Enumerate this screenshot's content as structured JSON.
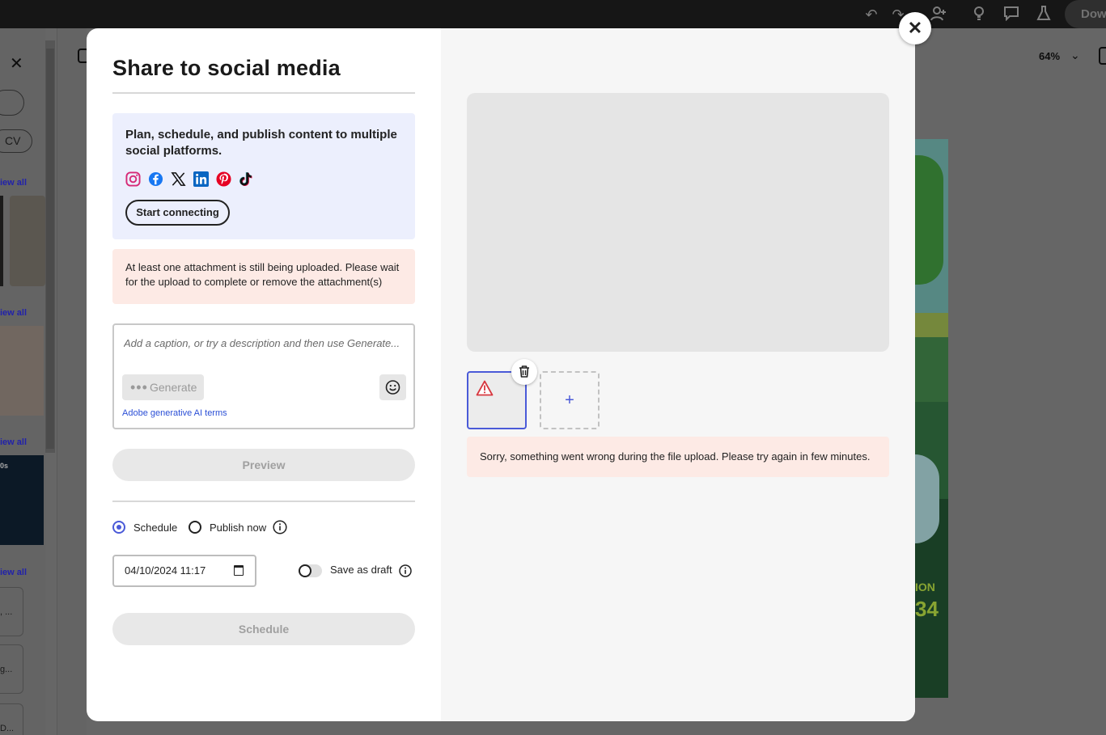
{
  "background": {
    "download_label": "Dow",
    "pill_cv": "CV",
    "view_all_label": "iew all",
    "docs": [
      ", ...",
      "g...",
      "D..."
    ],
    "thumb_text": "0s",
    "zoom_level": "64%",
    "poster_text1": "ION",
    "poster_text2": "34"
  },
  "modal": {
    "title": "Share to social media",
    "promo": {
      "text": "Plan, schedule, and publish content to multiple social platforms.",
      "start_label": "Start connecting",
      "platforms": [
        "instagram-icon",
        "facebook-icon",
        "x-icon",
        "linkedin-icon",
        "pinterest-icon",
        "tiktok-icon"
      ]
    },
    "upload_warning": "At least one attachment is still being uploaded. Please wait for the upload to complete or remove the attachment(s)",
    "caption": {
      "placeholder": "Add a caption, or try a description and then use Generate...",
      "generate_label": "Generate",
      "ai_terms": "Adobe generative AI terms"
    },
    "preview_label": "Preview",
    "publish_options": {
      "schedule_label": "Schedule",
      "publish_now_label": "Publish now",
      "selected": "schedule"
    },
    "date_value": "04/10/2024 11:17",
    "save_draft_label": "Save as draft",
    "save_draft_on": false,
    "schedule_button_label": "Schedule",
    "upload_error": "Sorry, something went wrong during the file upload. Please try again in few minutes.",
    "add_attachment_symbol": "+"
  },
  "colors": {
    "accent": "#4a5ad8",
    "promo_bg": "#eceffd",
    "warning_bg": "#fdeae5",
    "link": "#2b4fd6"
  }
}
